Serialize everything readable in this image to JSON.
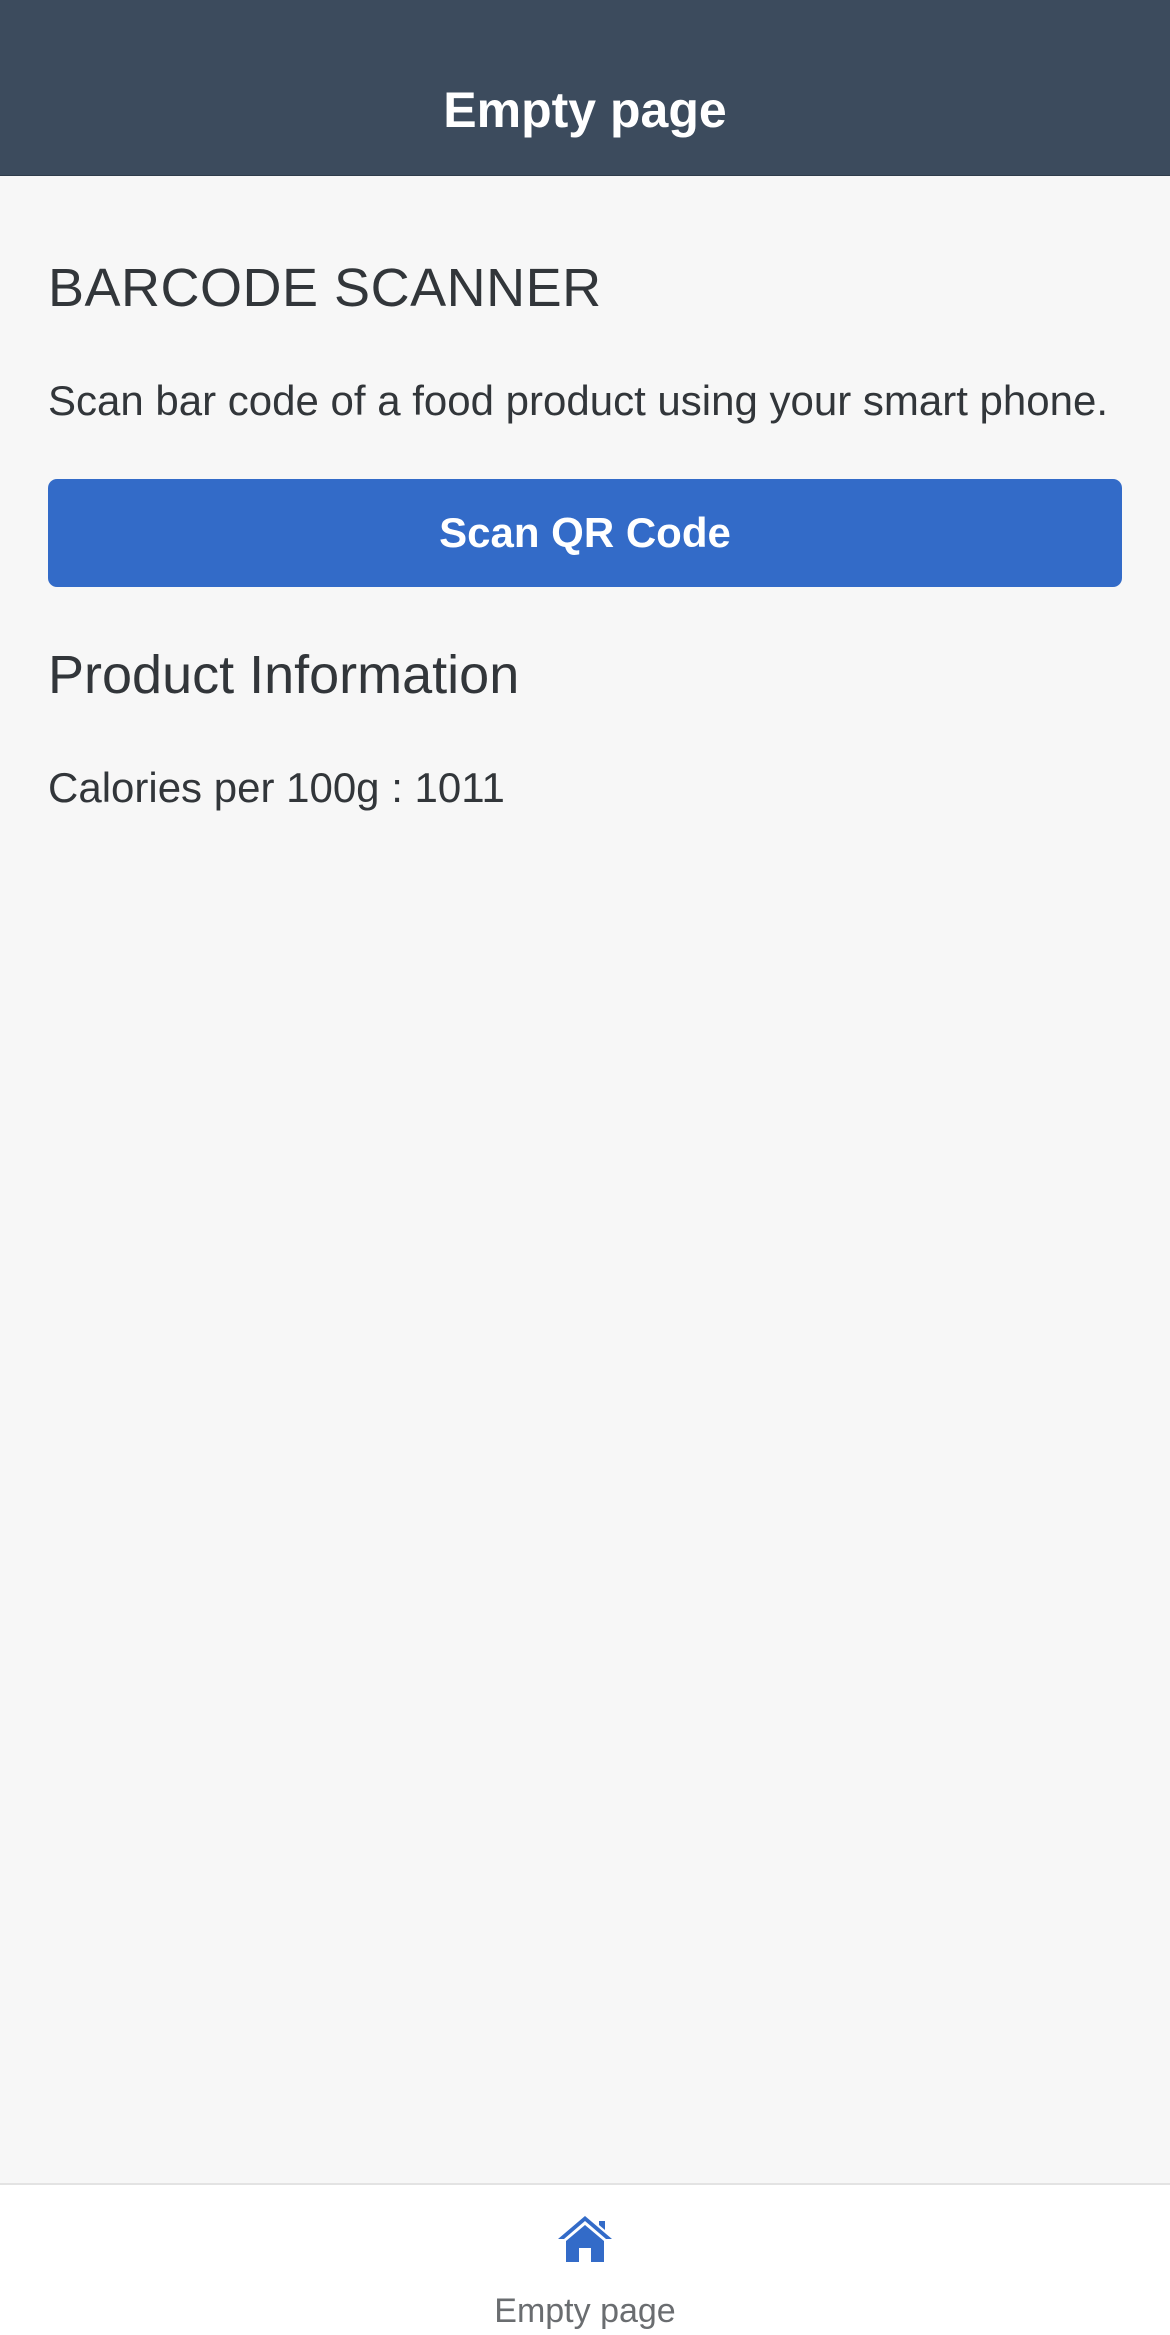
{
  "header": {
    "title": "Empty page"
  },
  "main": {
    "scanner_heading": "BARCODE SCANNER",
    "scanner_description": "Scan bar code of a food product using your smart phone.",
    "scan_button_label": "Scan QR Code",
    "product_heading": "Product Information",
    "calories_text": "Calories per 100g : 1011"
  },
  "tabbar": {
    "items": [
      {
        "label": "Empty page",
        "icon": "home-icon",
        "active": true
      }
    ]
  },
  "colors": {
    "header_bg": "#3c4b5d",
    "accent": "#336bc8",
    "page_bg": "#f7f7f7",
    "text": "#32363a",
    "tab_label": "#6a6d70"
  }
}
